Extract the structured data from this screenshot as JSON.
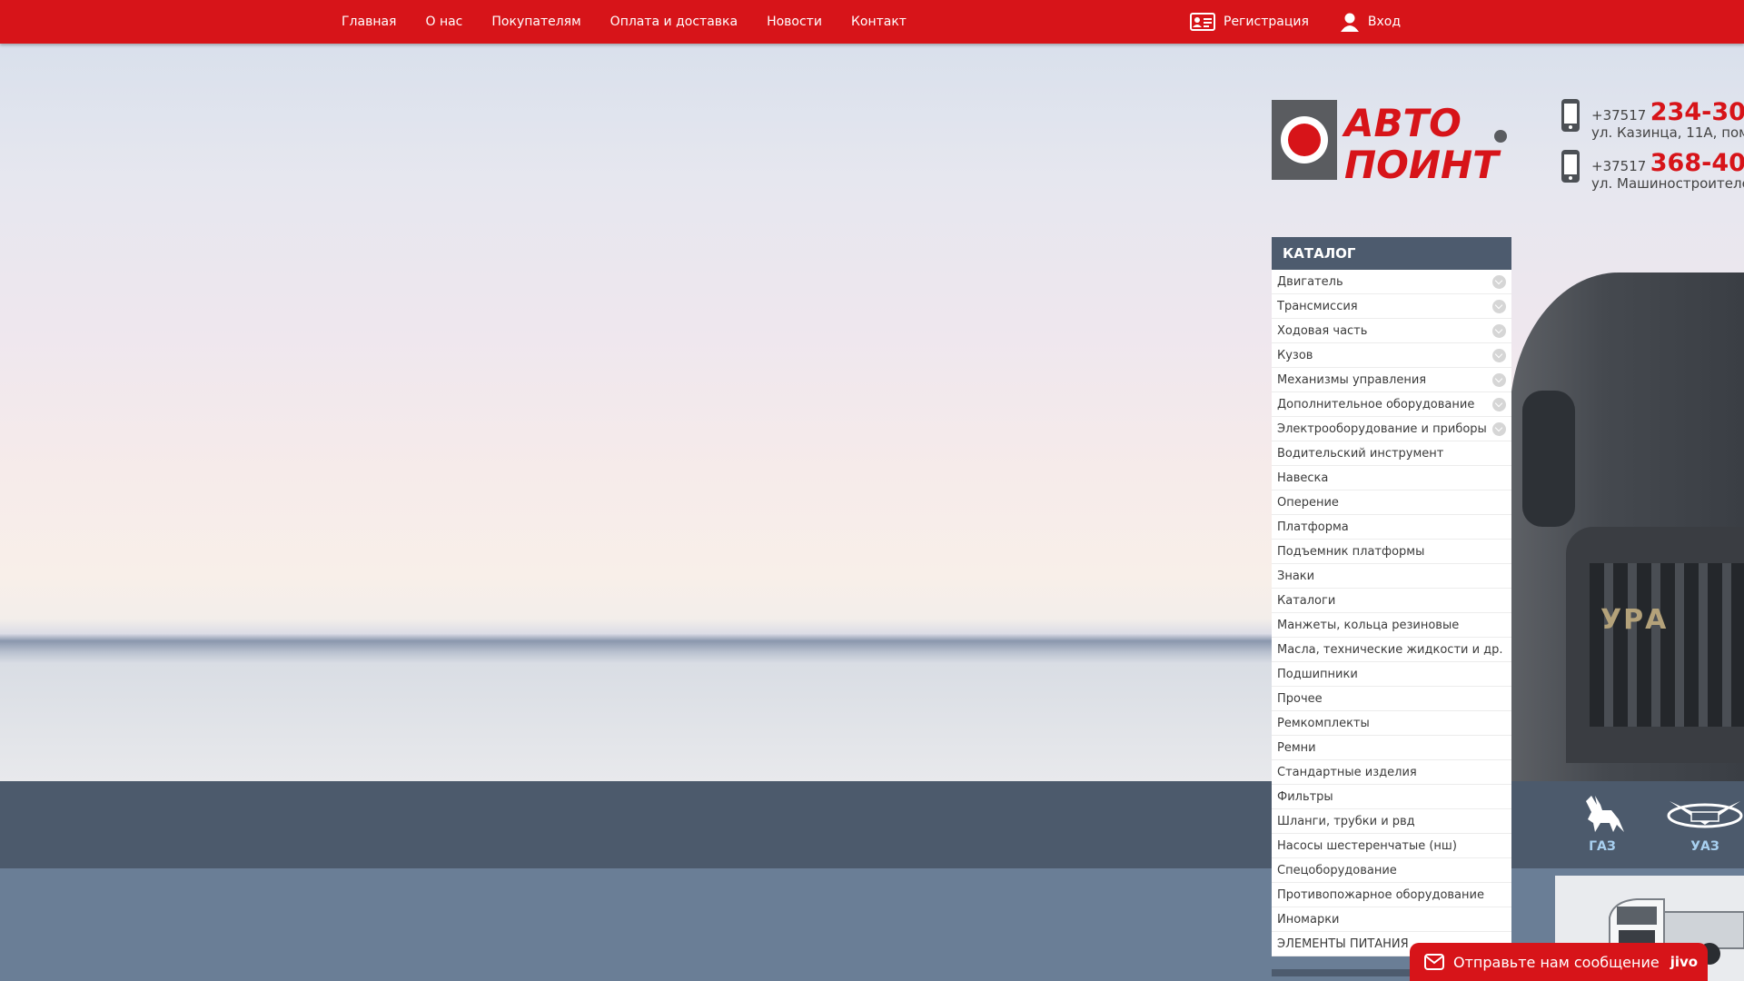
{
  "nav": {
    "items": [
      {
        "label": "Главная"
      },
      {
        "label": "О нас"
      },
      {
        "label": "Покупателям"
      },
      {
        "label": "Оплата и доставка"
      },
      {
        "label": "Новости"
      },
      {
        "label": "Контакт"
      }
    ],
    "register_label": "Регистрация",
    "login_label": "Вход"
  },
  "logo": {
    "line1": "АВТО",
    "line2": "ПОИНТ"
  },
  "contacts": [
    {
      "prefix": "+37517",
      "number": "234-30-",
      "address": "ул. Казинца, 11А, пом."
    },
    {
      "prefix": "+37517",
      "number": "368-40-",
      "address": "ул. Машиностроителе"
    }
  ],
  "catalog": {
    "title": "КАТАЛОГ",
    "items": [
      {
        "label": "Двигатель",
        "expandable": true
      },
      {
        "label": "Трансмиссия",
        "expandable": true
      },
      {
        "label": "Ходовая часть",
        "expandable": true
      },
      {
        "label": "Кузов",
        "expandable": true
      },
      {
        "label": "Механизмы управления",
        "expandable": true
      },
      {
        "label": "Дополнительное оборудование",
        "expandable": true
      },
      {
        "label": "Электрооборудование и приборы",
        "expandable": true
      },
      {
        "label": "Водительский инструмент",
        "expandable": false
      },
      {
        "label": "Навеска",
        "expandable": false
      },
      {
        "label": "Оперение",
        "expandable": false
      },
      {
        "label": "Платформа",
        "expandable": false
      },
      {
        "label": "Подъемник платформы",
        "expandable": false
      },
      {
        "label": "Знаки",
        "expandable": false
      },
      {
        "label": "Каталоги",
        "expandable": false
      },
      {
        "label": "Манжеты, кольца резиновые",
        "expandable": false
      },
      {
        "label": "Масла, технические жидкости и др.",
        "expandable": false
      },
      {
        "label": "Подшипники",
        "expandable": false
      },
      {
        "label": "Прочее",
        "expandable": false
      },
      {
        "label": "Ремкомплекты",
        "expandable": false
      },
      {
        "label": "Ремни",
        "expandable": false
      },
      {
        "label": "Стандартные изделия",
        "expandable": false
      },
      {
        "label": "Фильтры",
        "expandable": false
      },
      {
        "label": "Шланги, трубки и рвд",
        "expandable": false
      },
      {
        "label": "Насосы шестеренчатые (нш)",
        "expandable": false
      },
      {
        "label": "Спецоборудование",
        "expandable": false
      },
      {
        "label": "Противопожарное оборудование",
        "expandable": false
      },
      {
        "label": "Иномарки",
        "expandable": false
      },
      {
        "label": "ЭЛЕМЕНТЫ ПИТАНИЯ",
        "expandable": false
      }
    ]
  },
  "hero": {
    "truck_badge": "УРА"
  },
  "brands": [
    {
      "label": "ГАЗ",
      "icon": "deer-icon"
    },
    {
      "label": "УАЗ",
      "icon": "uaz-bird-icon"
    }
  ],
  "chat": {
    "message": "Отправьте нам сообщение",
    "brand": "jivo"
  },
  "colors": {
    "brand_red": "#d71419",
    "dark_slate": "#4c5a6c",
    "catalog_head": "#4d5b6e",
    "brand_blue": "#a8d0f0"
  }
}
